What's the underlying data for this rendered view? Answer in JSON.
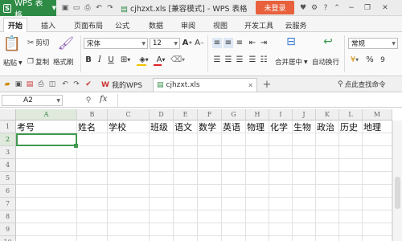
{
  "app": {
    "brand": "WPS 表格",
    "doc_title": "cjhzxt.xls [兼容模式] - WPS 表格",
    "login": "未登录"
  },
  "ribbon_tabs": [
    "开始",
    "插入",
    "页面布局",
    "公式",
    "数据",
    "审阅",
    "视图",
    "开发工具",
    "云服务"
  ],
  "ribbon": {
    "paste": "粘贴",
    "cut": "剪切",
    "copy": "复制",
    "format_painter": "格式刷",
    "font_name": "宋体",
    "font_size": "12",
    "merge_center": "合并居中",
    "auto_wrap": "自动换行",
    "number_format": "常规",
    "currency": "¥",
    "percent": "%",
    "thousands": "9"
  },
  "doc_tabs": {
    "home": "我的WPS",
    "file": "cjhzxt.xls",
    "search_hint": "点此查找命令"
  },
  "formula_bar": {
    "cell_ref": "A2",
    "fx": "fx",
    "value": ""
  },
  "grid": {
    "columns": [
      "A",
      "B",
      "C",
      "D",
      "E",
      "F",
      "G",
      "H",
      "I",
      "J",
      "K",
      "L",
      "M"
    ],
    "rows": [
      "1",
      "2",
      "3",
      "4",
      "5",
      "6",
      "7",
      "8",
      "9",
      "10",
      "11",
      "12",
      "13"
    ],
    "row1": [
      "考号",
      "姓名",
      "学校",
      "班级",
      "语文",
      "数学",
      "英语",
      "物理",
      "化学",
      "生物",
      "政治",
      "历史",
      "地理"
    ],
    "selected": "A2"
  },
  "colors": {
    "wps_green": "#2e8b46",
    "login_orange": "#e8603c",
    "selection_green": "#3f9a4f"
  }
}
